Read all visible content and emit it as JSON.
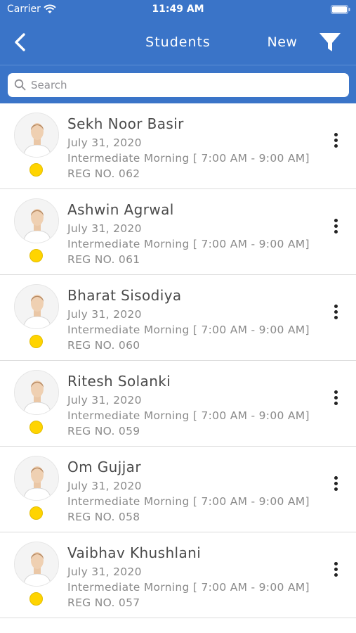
{
  "status_bar": {
    "carrier": "Carrier",
    "time": "11:49 AM"
  },
  "nav": {
    "title": "Students",
    "new_label": "New"
  },
  "search": {
    "placeholder": "Search",
    "value": ""
  },
  "colors": {
    "header": "#3a74c8",
    "status_dot": "#ffd400"
  },
  "students": [
    {
      "name": "Sekh Noor Basir",
      "date": "July 31, 2020",
      "batch": "Intermediate Morning [ 7:00 AM - 9:00 AM]",
      "reg": "REG NO. 062"
    },
    {
      "name": "Ashwin Agrwal",
      "date": "July 31, 2020",
      "batch": "Intermediate Morning [ 7:00 AM - 9:00 AM]",
      "reg": "REG NO. 061"
    },
    {
      "name": "Bharat Sisodiya",
      "date": "July 31, 2020",
      "batch": "Intermediate Morning [ 7:00 AM - 9:00 AM]",
      "reg": "REG NO. 060"
    },
    {
      "name": "Ritesh Solanki",
      "date": "July 31, 2020",
      "batch": "Intermediate Morning [ 7:00 AM - 9:00 AM]",
      "reg": "REG NO. 059"
    },
    {
      "name": "Om Gujjar",
      "date": "July 31, 2020",
      "batch": "Intermediate Morning [ 7:00 AM - 9:00 AM]",
      "reg": "REG NO. 058"
    },
    {
      "name": "Vaibhav Khushlani",
      "date": "July 31, 2020",
      "batch": "Intermediate Morning [ 7:00 AM - 9:00 AM]",
      "reg": "REG NO. 057"
    }
  ]
}
